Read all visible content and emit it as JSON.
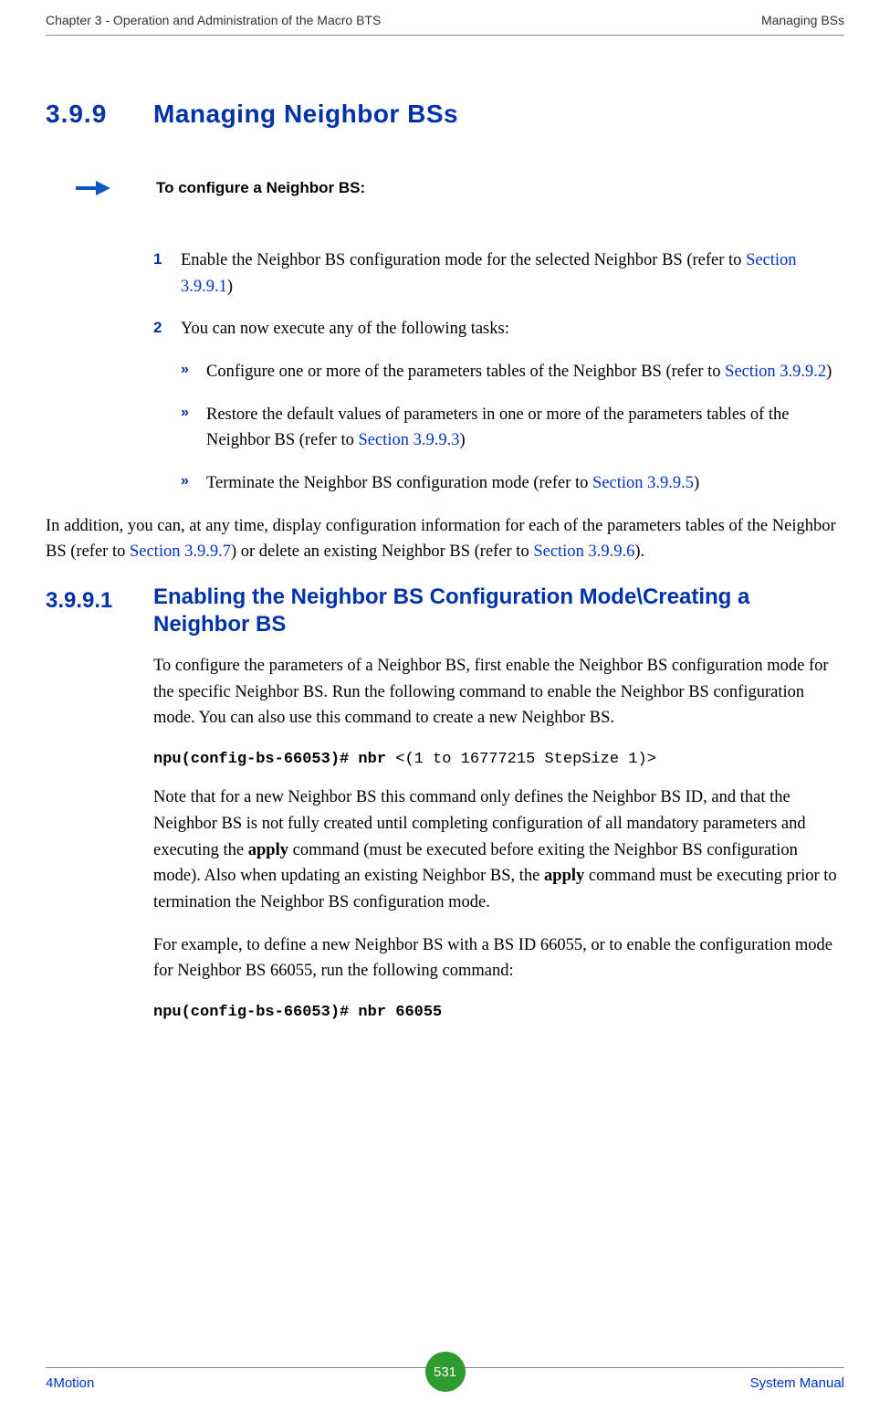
{
  "header": {
    "left": "Chapter 3 - Operation and Administration of the Macro BTS",
    "right": "Managing BSs"
  },
  "section": {
    "number": "3.9.9",
    "title": "Managing Neighbor BSs"
  },
  "to_configure": "To configure a Neighbor BS:",
  "steps": {
    "s1": {
      "num": "1",
      "text_a": "Enable the Neighbor BS configuration mode for the selected Neighbor BS (refer to ",
      "link": "Section 3.9.9.1",
      "text_b": ")"
    },
    "s2": {
      "num": "2",
      "text": "You can now execute any of the following tasks:"
    }
  },
  "bullets": {
    "b1": {
      "text_a": "Configure one or more of the parameters tables of the Neighbor BS (refer to ",
      "link": "Section 3.9.9.2",
      "text_b": ")"
    },
    "b2": {
      "text_a": "Restore the default values of parameters in one or more of the parameters tables of the Neighbor BS (refer to ",
      "link": "Section 3.9.9.3",
      "text_b": ")"
    },
    "b3": {
      "text_a": " Terminate the Neighbor BS configuration mode (refer to ",
      "link": "Section 3.9.9.5",
      "text_b": ")"
    }
  },
  "addition_para": {
    "a": "In addition, you can, at any time, display configuration information for each of the parameters tables of the Neighbor BS (refer to ",
    "link1": "Section 3.9.9.7",
    "b": ") or delete an existing Neighbor BS (refer to ",
    "link2": "Section 3.9.9.6",
    "c": ")."
  },
  "subsection": {
    "number": "3.9.9.1",
    "title": "Enabling the Neighbor BS Configuration Mode\\Creating a Neighbor BS"
  },
  "sub_para1": "To configure the parameters of a Neighbor BS, first enable the Neighbor BS configuration mode for the specific Neighbor BS. Run the following command to enable the Neighbor BS configuration mode. You can also use this command to create a new Neighbor BS.",
  "cmd1": {
    "bold": "npu(config-bs-66053)# nbr ",
    "rest": "<(1 to 16777215 StepSize 1)>"
  },
  "sub_para2": {
    "a": "Note that for a new Neighbor BS this command only defines the Neighbor BS ID, and that the Neighbor BS is not fully created until completing configuration of all mandatory parameters and executing the ",
    "b_bold": "apply",
    "c": " command (must be executed before exiting the Neighbor BS configuration mode). Also when updating an existing Neighbor BS, the ",
    "d_bold": "apply",
    "e": " command must be executing prior to termination the Neighbor BS configuration mode."
  },
  "sub_para3": "For example, to define a new Neighbor BS with a BS ID 66055, or to enable the configuration mode for Neighbor BS 66055, run the following command:",
  "cmd2": "npu(config-bs-66053)# nbr 66055",
  "footer": {
    "left": "4Motion",
    "page": "531",
    "right": "System Manual"
  },
  "chevron": "»"
}
